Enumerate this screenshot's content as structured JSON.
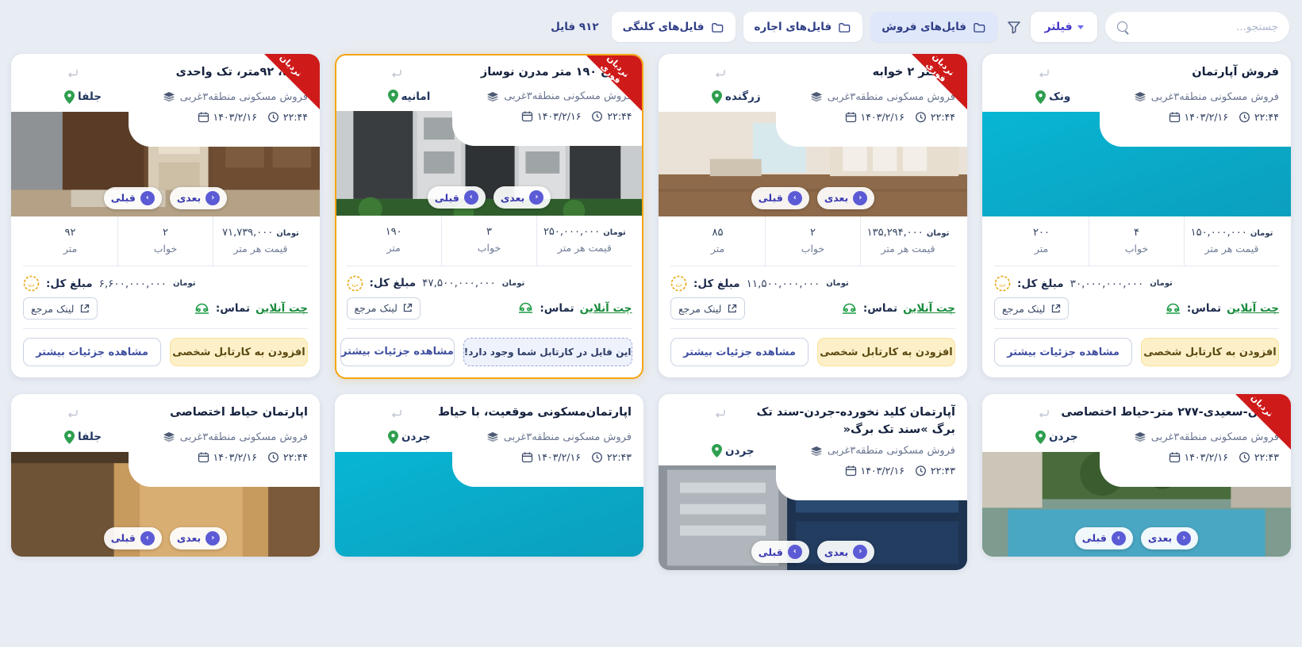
{
  "toolbar": {
    "search_placeholder": "جستجو...",
    "filter_label": "فیلتر",
    "funnel_icon": "funnel-icon",
    "search_icon": "search-icon",
    "tabs": [
      {
        "label": "فایل‌های فروش",
        "active": true
      },
      {
        "label": "فایل‌های اجاره",
        "active": false
      },
      {
        "label": "فایل‌های کلنگی",
        "active": false
      }
    ],
    "file_count": "۹۱۲ فایل"
  },
  "labels": {
    "meter": "متر",
    "bed": "خواب",
    "price_per_meter": "قیمت هر متر",
    "total_label": "مبلغ کل:",
    "contact_label": "تماس:",
    "chat_online": "چت آنلاین",
    "ref_link": "لینک مرجع",
    "more_details": "مشاهده جزئیات بیشتر",
    "add_to_cartable": "افزودن به کارتابل شخصی",
    "already_in_cartable": "این فایل در کارتابل شما وجود دارد!",
    "toman": "تومان",
    "prev": "قبلی",
    "next": "بعدی",
    "badge_ladder": "نردبان",
    "badge_instant": "نردبان فوری"
  },
  "colors": {
    "accent": "#4338ca",
    "highlight_border": "#f5a515",
    "ribbon": "#cf1a1a",
    "chat_green": "#198b3c",
    "warn_bg": "#fdf0c8",
    "page_bg": "#e8ecf3"
  },
  "cards": [
    {
      "title": "فروش آپارتمان",
      "location": "ونک",
      "category": "فروش مسکونی منطقه۳غربی",
      "date": "۱۴۰۳/۲/۱۶",
      "time": "۲۲:۴۴",
      "badge": "",
      "area": "۲۰۰",
      "beds": "۴",
      "price_per_meter": "۱۵۰,۰۰۰,۰۰۰",
      "total_price": "۳۰,۰۰۰,۰۰۰,۰۰۰",
      "photo": "placeholder",
      "carousel": false,
      "in_cartable": false
    },
    {
      "title": "۸۵ متر ۲ خوابه",
      "location": "زرگنده",
      "category": "فروش مسکونی منطقه۳غربی",
      "date": "۱۴۰۳/۲/۱۶",
      "time": "۲۲:۴۴",
      "badge": "نردبان فوری",
      "area": "۸۵",
      "beds": "۲",
      "price_per_meter": "۱۳۵,۲۹۴,۰۰۰",
      "total_price": "۱۱,۵۰۰,۰۰۰,۰۰۰",
      "photo": "interior-light",
      "carousel": true,
      "in_cartable": false
    },
    {
      "title": "جردن ۱۹۰ متر مدرن نوساز",
      "location": "امانیه",
      "category": "فروش مسکونی منطقه۳غربی",
      "date": "۱۴۰۳/۲/۱۶",
      "time": "۲۲:۴۴",
      "badge": "نردبان فوری",
      "area": "۱۹۰",
      "beds": "۳",
      "price_per_meter": "۲۵۰,۰۰۰,۰۰۰",
      "total_price": "۴۷,۵۰۰,۰۰۰,۰۰۰",
      "photo": "building-facade",
      "carousel": true,
      "in_cartable": true,
      "highlight": true
    },
    {
      "title": "جلفا، ۹۲متر، تک واحدی",
      "location": "جلفا",
      "category": "فروش مسکونی منطقه۳غربی",
      "date": "۱۴۰۳/۲/۱۶",
      "time": "۲۲:۴۴",
      "badge": "نردبان",
      "area": "۹۲",
      "beds": "۲",
      "price_per_meter": "۷۱,۷۳۹,۰۰۰",
      "total_price": "۶,۶۰۰,۰۰۰,۰۰۰",
      "photo": "kitchen-wood",
      "carousel": true,
      "in_cartable": false
    },
    {
      "title": "جردن-سعیدی-۲۷۷ متر-حیاط اختصاصی",
      "location": "جردن",
      "category": "فروش مسکونی منطقه۳غربی",
      "date": "۱۴۰۳/۲/۱۶",
      "time": "۲۲:۴۳",
      "badge": "نردبان",
      "photo": "garden-pool",
      "carousel": true
    },
    {
      "title": "آپارتمان کلید نخورده-جردن-سند تک برگ »سند تک برگ«",
      "location": "جردن",
      "category": "فروش مسکونی منطقه۳غربی",
      "date": "۱۴۰۳/۲/۱۶",
      "time": "۲۲:۴۳",
      "badge": "",
      "photo": "facade-glass",
      "carousel": true
    },
    {
      "title": "اپارتمان‌مسکونی موقعیت، با حیاط",
      "location": "جردن",
      "category": "فروش مسکونی منطقه۳غربی",
      "date": "۱۴۰۳/۲/۱۶",
      "time": "۲۲:۴۳",
      "badge": "",
      "photo": "placeholder",
      "carousel": false
    },
    {
      "title": "اپارتمان حیاط اختصاصی",
      "location": "جلفا",
      "category": "فروش مسکونی منطقه۳غربی",
      "date": "۱۴۰۳/۲/۱۶",
      "time": "۲۲:۴۴",
      "badge": "",
      "photo": "wood-interior",
      "carousel": true
    }
  ]
}
